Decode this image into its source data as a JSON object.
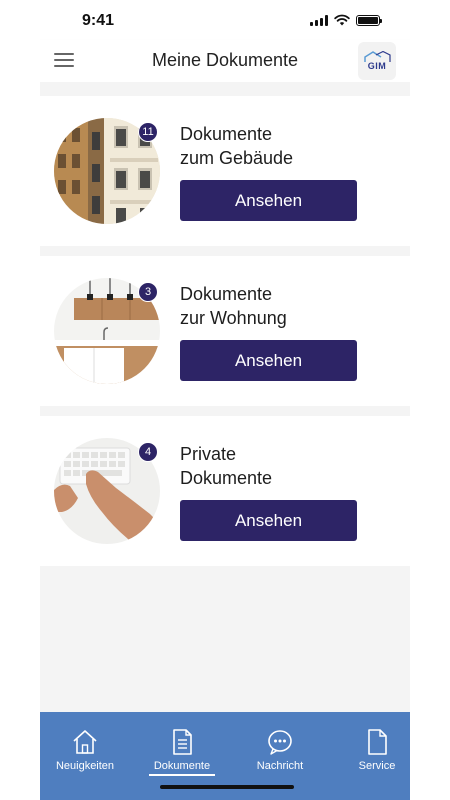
{
  "status_bar": {
    "time": "9:41"
  },
  "header": {
    "title": "Meine Dokumente",
    "logo_text": "GIM",
    "menu_icon": "hamburger-menu-icon"
  },
  "cards": [
    {
      "title_line1": "Dokumente",
      "title_line2": "zum Gebäude",
      "count": "11",
      "button_label": "Ansehen",
      "image": "building-facade-photo"
    },
    {
      "title_line1": "Dokumente",
      "title_line2": "zur Wohnung",
      "count": "3",
      "button_label": "Ansehen",
      "image": "kitchen-photo"
    },
    {
      "title_line1": "Private",
      "title_line2": "Dokumente",
      "count": "4",
      "button_label": "Ansehen",
      "image": "keyboard-hands-photo"
    }
  ],
  "tabbar": {
    "active": "Dokumente",
    "tabs": [
      {
        "label": "Neuigkeiten",
        "icon": "home-icon"
      },
      {
        "label": "Dokumente",
        "icon": "document-icon"
      },
      {
        "label": "Nachricht",
        "icon": "chat-bubble-icon"
      },
      {
        "label": "Service",
        "icon": "file-icon"
      }
    ]
  },
  "colors": {
    "accent": "#2d2466",
    "tabbar": "#4f7ebf",
    "background": "#f4f4f4"
  }
}
